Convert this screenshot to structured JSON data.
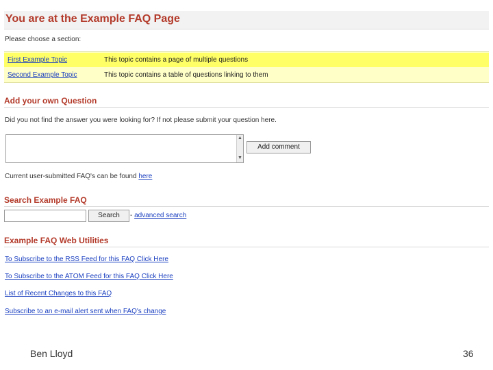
{
  "page_title": "You are at the Example FAQ Page",
  "section_prompt": "Please choose a section:",
  "topics": [
    {
      "link": "First Example Topic",
      "description": "This topic contains a page of multiple questions"
    },
    {
      "link": "Second Example Topic",
      "description": "This topic contains a table of questions linking to them"
    }
  ],
  "add_question": {
    "heading": "Add your own Question",
    "prompt": "Did you not find the answer you were looking for? If not please submit your question here.",
    "textarea_value": "",
    "add_button": "Add comment",
    "user_faqs_text": "Current user-submitted FAQ's can be found",
    "user_faqs_link": "here"
  },
  "search": {
    "heading": "Search Example FAQ",
    "input_value": "",
    "button": "Search",
    "separator": "-",
    "advanced_link": "advanced search"
  },
  "utilities": {
    "heading": "Example FAQ Web Utilities",
    "links": [
      "To Subscribe to the RSS Feed for this FAQ Click Here",
      "To Subscribe to the ATOM Feed for this FAQ Click Here",
      "List of Recent Changes to this FAQ",
      "Subscribe to an e-mail alert sent when FAQ's change"
    ]
  },
  "footer": {
    "author": "Ben Lloyd",
    "page_number": "36"
  },
  "colors": {
    "heading": "#b33a2a",
    "link": "#1a3fc0",
    "topic_highlight": "#ffff66",
    "topic_background": "#ffffc8"
  }
}
